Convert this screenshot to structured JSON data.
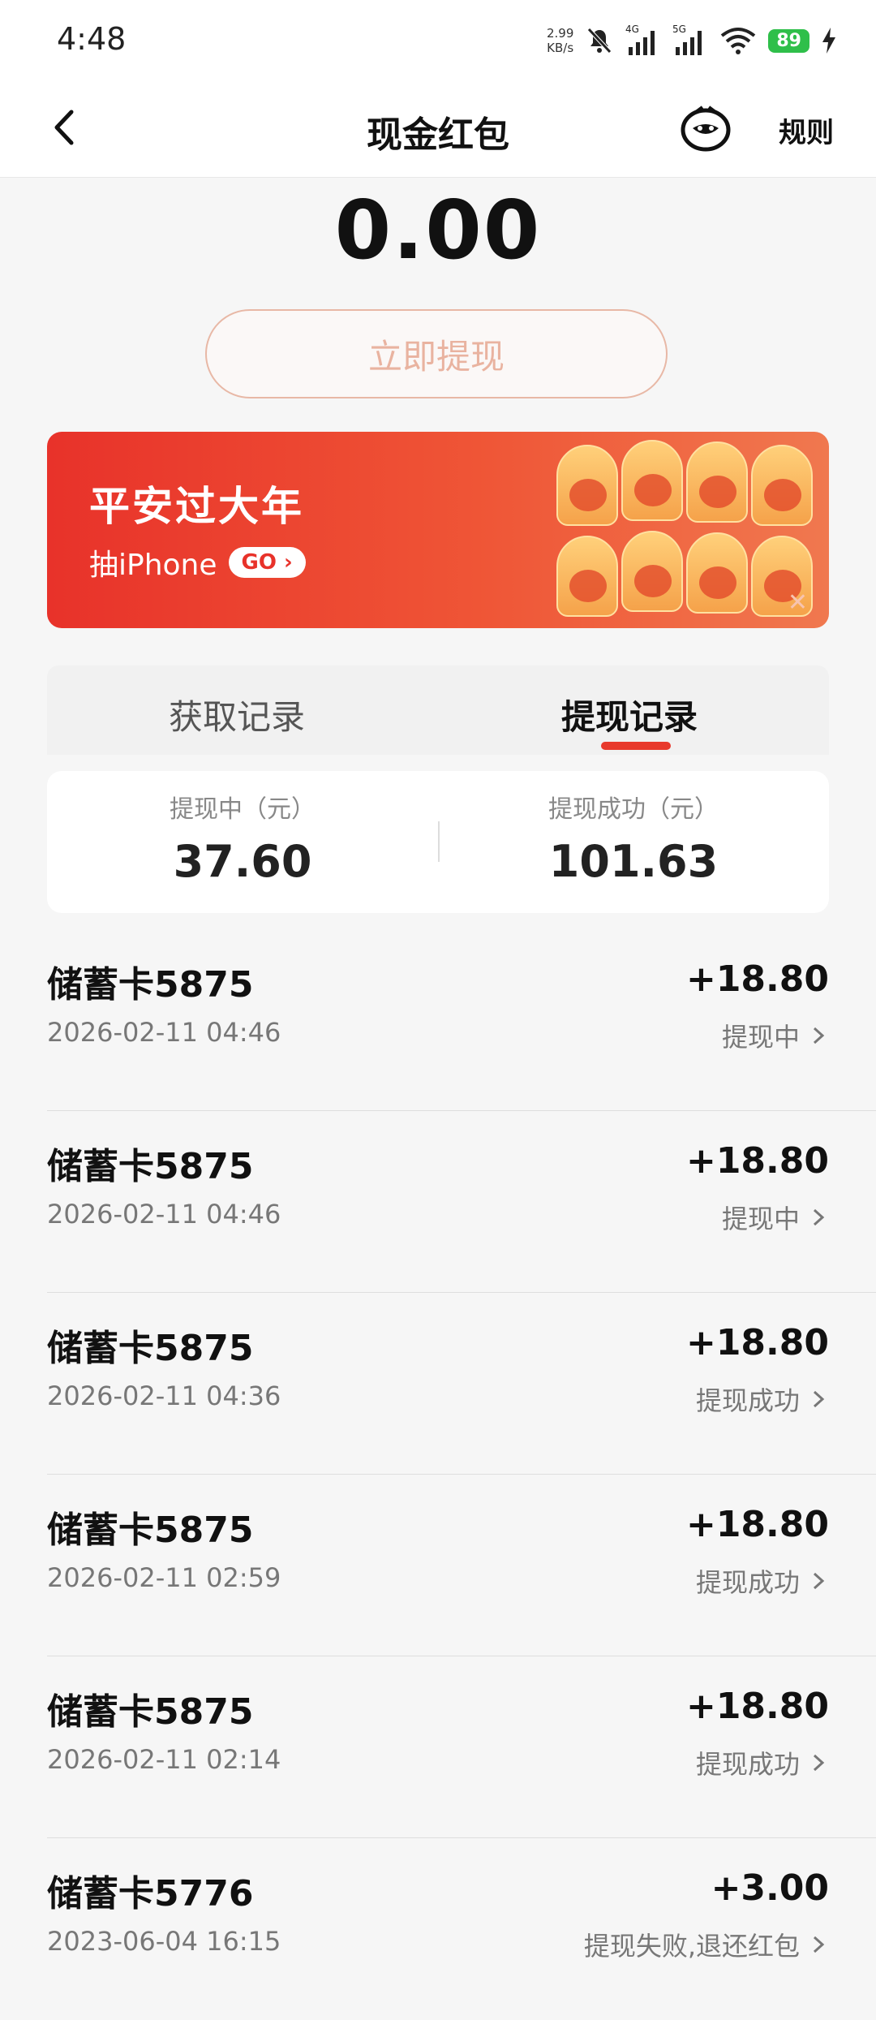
{
  "status_bar": {
    "time": "4:48",
    "net_speed_value": "2.99",
    "net_speed_unit": "KB/s",
    "net1": "4G",
    "net2": "5G",
    "battery": "89"
  },
  "header": {
    "title": "现金红包",
    "rules_label": "规则",
    "back_icon": "back-arrow-icon",
    "mascot_icon": "mascot-icon"
  },
  "balance": {
    "amount": "0.00",
    "withdraw_label": "立即提现"
  },
  "banner": {
    "title": "平安过大年",
    "subtitle": "抽iPhone",
    "go_label": "GO",
    "close_glyph": "✕"
  },
  "tabs": [
    {
      "label": "获取记录",
      "active": false
    },
    {
      "label": "提现记录",
      "active": true
    }
  ],
  "summary": {
    "pending_label": "提现中（元）",
    "pending_value": "37.60",
    "success_label": "提现成功（元）",
    "success_value": "101.63"
  },
  "records": [
    {
      "name": "储蓄卡5875",
      "date": "2026-02-11 04:46",
      "amount": "+18.80",
      "status": "提现中"
    },
    {
      "name": "储蓄卡5875",
      "date": "2026-02-11 04:46",
      "amount": "+18.80",
      "status": "提现中"
    },
    {
      "name": "储蓄卡5875",
      "date": "2026-02-11 04:36",
      "amount": "+18.80",
      "status": "提现成功"
    },
    {
      "name": "储蓄卡5875",
      "date": "2026-02-11 02:59",
      "amount": "+18.80",
      "status": "提现成功"
    },
    {
      "name": "储蓄卡5875",
      "date": "2026-02-11 02:14",
      "amount": "+18.80",
      "status": "提现成功"
    },
    {
      "name": "储蓄卡5776",
      "date": "2023-06-04 16:15",
      "amount": "+3.00",
      "status": "提现失败,退还红包"
    }
  ],
  "colors": {
    "accent": "#e8392c",
    "banner_start": "#e8322a",
    "banner_end": "#f0784f",
    "battery": "#2fbf4a"
  }
}
